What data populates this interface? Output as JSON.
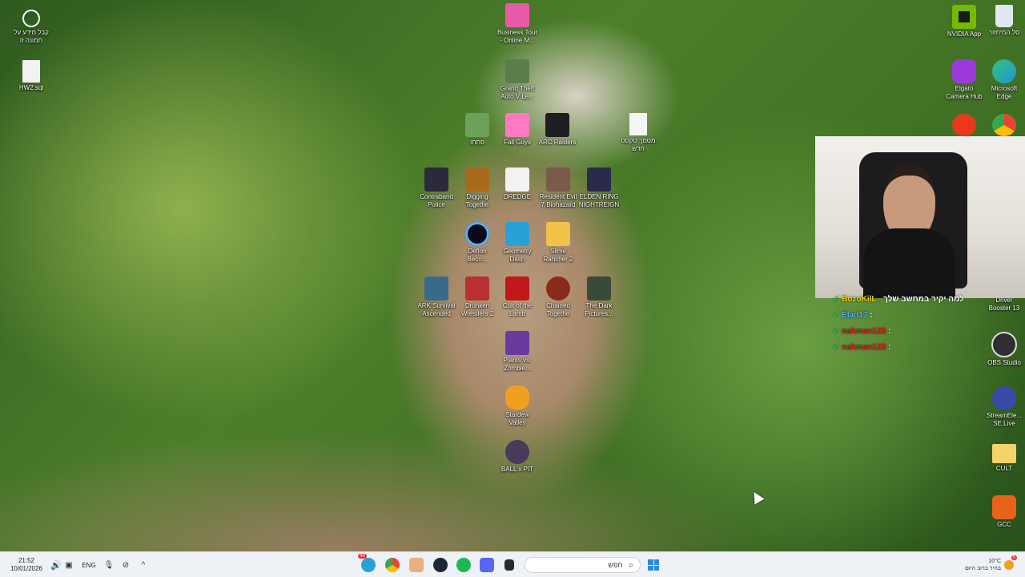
{
  "desktop_icons": [
    {
      "label": "קבל מידע על\nתמונה זו",
      "icon": "info-camera-icon",
      "color": "#ffffff"
    },
    {
      "label": "HW2.sql",
      "icon": "file-icon",
      "color": "#f2f2f2"
    },
    {
      "label": "Business Tour\n- Online M...",
      "icon": "business-tour-icon",
      "color": "#e85aa8"
    },
    {
      "label": "Grand Theft\nAuto V Le...",
      "icon": "gta-icon",
      "color": "#5a7d4a"
    },
    {
      "label": "פתחו",
      "icon": "game-anime-icon",
      "color": "#6da05a"
    },
    {
      "label": "Fall Guys",
      "icon": "fall-guys-icon",
      "color": "#ff7ac3"
    },
    {
      "label": "ARC Raiders",
      "icon": "arc-raiders-icon",
      "color": "#1e1e22"
    },
    {
      "label": "מסמך טקסט\nחדש",
      "icon": "text-file-icon",
      "color": "#f5f5f5"
    },
    {
      "label": "Contraband\nPolice",
      "icon": "contraband-icon",
      "color": "#2a2a3c"
    },
    {
      "label": "Digging\nTogethe",
      "icon": "dt-icon",
      "color": "#a86a1c"
    },
    {
      "label": "DREDGE",
      "icon": "dredge-icon",
      "color": "#f2f2f2"
    },
    {
      "label": "Resident Evil\n7 Biohazard",
      "icon": "re7-icon",
      "color": "#7a5a4a"
    },
    {
      "label": "ELDEN RING\nNIGHTREIGN",
      "icon": "elden-ring-icon",
      "color": "#2a2a4a"
    },
    {
      "label": "Deflon\nBeco...",
      "icon": "deflon-icon",
      "color": "#0a0a1a"
    },
    {
      "label": "Geometry\nDash",
      "icon": "geometry-dash-icon",
      "color": "#2aa0d8"
    },
    {
      "label": "Slime\nRancher 2",
      "icon": "slime-rancher-icon",
      "color": "#f0c24a"
    },
    {
      "label": "ARK Survival\nAscended",
      "icon": "ark-icon",
      "color": "#3a6a8a"
    },
    {
      "label": "Drunken\nWrestlers 2",
      "icon": "drunken-wrestlers-icon",
      "color": "#b83030"
    },
    {
      "label": "Cult of the\nLamb",
      "icon": "cult-lamb-icon",
      "color": "#c01818"
    },
    {
      "label": "Chained\nTogethe",
      "icon": "chained-icon",
      "color": "#8a2a1a"
    },
    {
      "label": "The Dark\nPictures...",
      "icon": "dark-pictures-icon",
      "color": "#3a4a3a"
    },
    {
      "label": "Plants vs.\nZombie...",
      "icon": "pvz-icon",
      "color": "#6a3aa0"
    },
    {
      "label": "Stardew\nValley",
      "icon": "stardew-icon",
      "color": "#f0a020"
    },
    {
      "label": "BALL x PIT",
      "icon": "ballxpit-icon",
      "color": "#4a3a5a"
    },
    {
      "label": "NVIDIA App",
      "icon": "nvidia-icon",
      "color": "#76b900"
    },
    {
      "label": "סל המיחזור",
      "icon": "recycle-bin-icon",
      "color": "#dfe8f0"
    },
    {
      "label": "Elgato\nCamera Hub",
      "icon": "elgato-icon",
      "color": "#9a3ad8"
    },
    {
      "label": "Microsoft\nEdge",
      "icon": "edge-icon",
      "color": "#1a9ad8"
    },
    {
      "label": "",
      "icon": "ea-icon",
      "color": "#e83a1a"
    },
    {
      "label": "",
      "icon": "chrome-icon",
      "color": "#34a853"
    },
    {
      "label": "Driver\nBooster 13",
      "icon": "driver-booster-icon",
      "color": "#d83a2a"
    },
    {
      "label": "OBS Studio",
      "icon": "obs-icon",
      "color": "#302e31"
    },
    {
      "label": "StreamEle...\nSE.Live",
      "icon": "streamelements-icon",
      "color": "#3a4aa8"
    },
    {
      "label": "CULT",
      "icon": "folder-icon",
      "color": "#f5d36a"
    },
    {
      "label": "GCC",
      "icon": "gcc-icon",
      "color": "#e8621a"
    }
  ],
  "chat": [
    {
      "user": "BozoKilL",
      "text": "למה יקיר במחשב שלך",
      "color": "#f0d020"
    },
    {
      "user": "Elad17",
      "text": ":",
      "color": "#5ab0ff"
    },
    {
      "user": "nahman123",
      "text": ":",
      "color": "#e02020"
    },
    {
      "user": "nahman123",
      "text": ":",
      "color": "#e02020"
    }
  ],
  "taskbar": {
    "time": "21:52",
    "date": "10/01/2026",
    "language": "ENG",
    "search_placeholder": "חפש",
    "weather_temp": "10°C",
    "weather_desc": "בהיר ברוב היום",
    "notification_count": "5",
    "mail_badge": "49",
    "start_color": "#2a8ae0"
  }
}
